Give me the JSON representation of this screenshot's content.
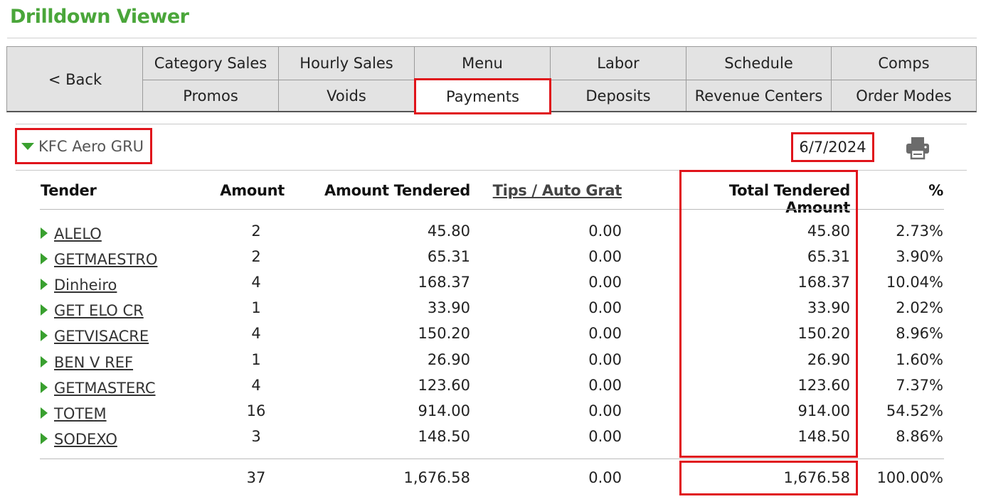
{
  "header": {
    "title": "Drilldown Viewer"
  },
  "nav": {
    "back_label": "< Back",
    "row1": [
      "Category Sales",
      "Hourly Sales",
      "Menu",
      "Labor",
      "Schedule",
      "Comps"
    ],
    "row2": [
      "Promos",
      "Voids",
      "Payments",
      "Deposits",
      "Revenue Centers",
      "Order Modes"
    ],
    "active": "Payments"
  },
  "store": {
    "name": "KFC Aero GRU"
  },
  "date": "6/7/2024",
  "table": {
    "columns": {
      "tender": "Tender",
      "amount": "Amount",
      "amount_tendered": "Amount Tendered",
      "tips": "Tips / Auto Grat",
      "total_tendered": "Total Tendered Amount",
      "percent": "%"
    },
    "rows": [
      {
        "tender": "ALELO",
        "amount": "2",
        "amount_tendered": "45.80",
        "tips": "0.00",
        "total": "45.80",
        "percent": "2.73%"
      },
      {
        "tender": "GETMAESTRO",
        "amount": "2",
        "amount_tendered": "65.31",
        "tips": "0.00",
        "total": "65.31",
        "percent": "3.90%"
      },
      {
        "tender": "Dinheiro",
        "amount": "4",
        "amount_tendered": "168.37",
        "tips": "0.00",
        "total": "168.37",
        "percent": "10.04%"
      },
      {
        "tender": "GET ELO CR",
        "amount": "1",
        "amount_tendered": "33.90",
        "tips": "0.00",
        "total": "33.90",
        "percent": "2.02%"
      },
      {
        "tender": "GETVISACRE",
        "amount": "4",
        "amount_tendered": "150.20",
        "tips": "0.00",
        "total": "150.20",
        "percent": "8.96%"
      },
      {
        "tender": "BEN V REF",
        "amount": "1",
        "amount_tendered": "26.90",
        "tips": "0.00",
        "total": "26.90",
        "percent": "1.60%"
      },
      {
        "tender": "GETMASTERC",
        "amount": "4",
        "amount_tendered": "123.60",
        "tips": "0.00",
        "total": "123.60",
        "percent": "7.37%"
      },
      {
        "tender": "TOTEM",
        "amount": "16",
        "amount_tendered": "914.00",
        "tips": "0.00",
        "total": "914.00",
        "percent": "54.52%"
      },
      {
        "tender": "SODEXO",
        "amount": "3",
        "amount_tendered": "148.50",
        "tips": "0.00",
        "total": "148.50",
        "percent": "8.86%"
      }
    ],
    "totals": {
      "amount": "37",
      "amount_tendered": "1,676.58",
      "tips": "0.00",
      "total": "1,676.58",
      "percent": "100.00%"
    }
  },
  "colors": {
    "brand_green": "#4aa63a",
    "highlight_red": "#e0141b",
    "nav_bg": "#e3e3e3"
  },
  "icons": {
    "expand": "triangle-right-icon",
    "collapse": "triangle-down-icon",
    "print": "printer-icon"
  }
}
